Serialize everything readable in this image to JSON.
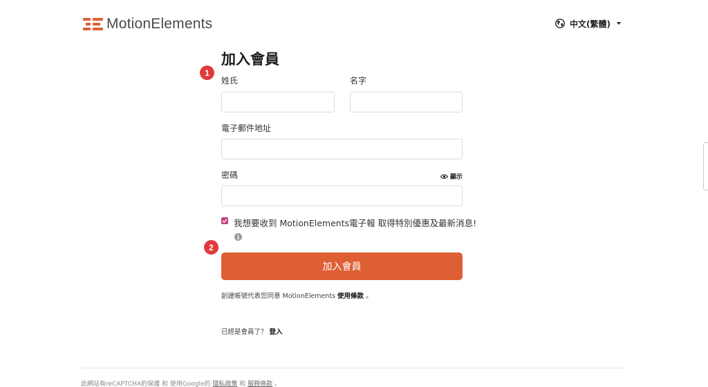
{
  "header": {
    "logo_text": "MotionElements",
    "language_label": "中文(繁體)"
  },
  "form": {
    "title": "加入會員",
    "badges": [
      "1",
      "2"
    ],
    "last_name_label": "姓氏",
    "first_name_label": "名字",
    "email_label": "電子郵件地址",
    "password_label": "密碼",
    "show_password_label": "顯示",
    "newsletter_checked": true,
    "newsletter_label": "我想要收到 MotionElements電子報 取得特別優惠及最新消息!",
    "info_icon_glyph": "i",
    "submit_label": "加入會員",
    "terms_prefix": "創建帳號代表您同意 MotionElements ",
    "terms_link": "使用條款",
    "terms_suffix": " 。",
    "login_prefix": "已經是會員了？ ",
    "login_link": "登入"
  },
  "footer": {
    "prefix": "此網站有reCAPTCHA的保護 和 使用Google的 ",
    "privacy_link": "隱私政策",
    "and": " 和 ",
    "tos_link": "服務條款",
    "suffix": " 。"
  },
  "colors": {
    "brand": "#df5f34",
    "badge": "#e0393b",
    "checkbox": "#c2407d"
  },
  "icons": [
    "logo-mark",
    "globe-icon",
    "eye-icon",
    "info-icon",
    "check-icon"
  ]
}
